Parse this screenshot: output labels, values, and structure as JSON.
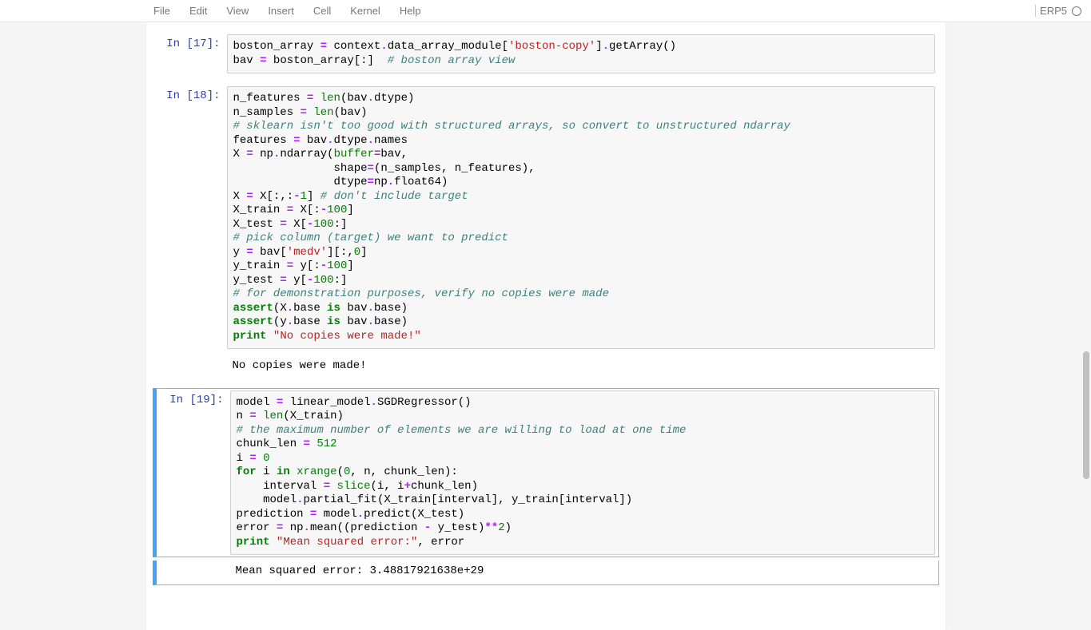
{
  "menu": {
    "file": "File",
    "edit": "Edit",
    "view": "View",
    "insert": "Insert",
    "cell": "Cell",
    "kernel": "Kernel",
    "help": "Help"
  },
  "kernel_name": "ERP5",
  "cells": {
    "c17": {
      "prompt": "In [17]:",
      "t0a": "boston_array ",
      "t0b": "=",
      "t0c": " context",
      "t0d": ".",
      "t0e": "data_array_module[",
      "t0f": "'boston-copy'",
      "t0g": "]",
      "t0h": ".",
      "t0i": "getArray()",
      "t1a": "bav ",
      "t1b": "=",
      "t1c": " boston_array[:]  ",
      "t1d": "# boston array view"
    },
    "c18": {
      "prompt": "In [18]:",
      "l0a": "n_features ",
      "l0b": "=",
      "l0c": " ",
      "l0d": "len",
      "l0e": "(bav",
      "l0f": ".",
      "l0g": "dtype)",
      "l1a": "n_samples ",
      "l1b": "=",
      "l1c": " ",
      "l1d": "len",
      "l1e": "(bav)",
      "l2": "",
      "l3": "# sklearn isn't too good with structured arrays, so convert to unstructured ndarray",
      "l4a": "features ",
      "l4b": "=",
      "l4c": " bav",
      "l4d": ".",
      "l4e": "dtype",
      "l4f": ".",
      "l4g": "names",
      "l5a": "X ",
      "l5b": "=",
      "l5c": " np",
      "l5d": ".",
      "l5e": "ndarray(",
      "l5f": "buffer",
      "l5g": "=",
      "l5h": "bav,",
      "l6a": "               shape",
      "l6b": "=",
      "l6c": "(n_samples, n_features),",
      "l7a": "               dtype",
      "l7b": "=",
      "l7c": "np",
      "l7d": ".",
      "l7e": "float64)",
      "l8": "",
      "l9a": "X ",
      "l9b": "=",
      "l9c": " X[:,:",
      "l9d": "-",
      "l9e": "1",
      "l9f": "] ",
      "l9g": "# don't include target",
      "l10": "",
      "l11a": "X_train ",
      "l11b": "=",
      "l11c": " X[:",
      "l11d": "-",
      "l11e": "100",
      "l11f": "]",
      "l12a": "X_test ",
      "l12b": "=",
      "l12c": " X[",
      "l12d": "-",
      "l12e": "100",
      "l12f": ":]",
      "l13": "",
      "l14": "# pick column (target) we want to predict",
      "l15a": "y ",
      "l15b": "=",
      "l15c": " bav[",
      "l15d": "'medv'",
      "l15e": "][:,",
      "l15f": "0",
      "l15g": "]",
      "l16a": "y_train ",
      "l16b": "=",
      "l16c": " y[:",
      "l16d": "-",
      "l16e": "100",
      "l16f": "]",
      "l17a": "y_test ",
      "l17b": "=",
      "l17c": " y[",
      "l17d": "-",
      "l17e": "100",
      "l17f": ":]",
      "l18": "",
      "l19": "# for demonstration purposes, verify no copies were made",
      "l20a": "assert",
      "l20b": "(X",
      "l20c": ".",
      "l20d": "base ",
      "l20e": "is",
      "l20f": " bav",
      "l20g": ".",
      "l20h": "base)",
      "l21a": "assert",
      "l21b": "(y",
      "l21c": ".",
      "l21d": "base ",
      "l21e": "is",
      "l21f": " bav",
      "l21g": ".",
      "l21h": "base)",
      "l22": "",
      "l23a": "print",
      "l23b": " ",
      "l23c": "\"No copies were made!\"",
      "output": "No copies were made!"
    },
    "c19": {
      "prompt": "In [19]:",
      "m0a": "model ",
      "m0b": "=",
      "m0c": " linear_model",
      "m0d": ".",
      "m0e": "SGDRegressor()",
      "m1a": "n ",
      "m1b": "=",
      "m1c": " ",
      "m1d": "len",
      "m1e": "(X_train)",
      "m2": "# the maximum number of elements we are willing to load at one time",
      "m3a": "chunk_len ",
      "m3b": "=",
      "m3c": " ",
      "m3d": "512",
      "m4a": "i ",
      "m4b": "=",
      "m4c": " ",
      "m4d": "0",
      "m5": "",
      "m6a": "for",
      "m6b": " i ",
      "m6c": "in",
      "m6d": " ",
      "m6e": "xrange",
      "m6f": "(",
      "m6g": "0",
      "m6h": ", n, chunk_len):",
      "m7a": "    interval ",
      "m7b": "=",
      "m7c": " ",
      "m7d": "slice",
      "m7e": "(i, i",
      "m7f": "+",
      "m7g": "chunk_len)",
      "m8a": "    model",
      "m8b": ".",
      "m8c": "partial_fit(X_train[interval], y_train[interval])",
      "m9": "",
      "m10a": "prediction ",
      "m10b": "=",
      "m10c": " model",
      "m10d": ".",
      "m10e": "predict(X_test)",
      "m11": "",
      "m12a": "error ",
      "m12b": "=",
      "m12c": " np",
      "m12d": ".",
      "m12e": "mean((prediction ",
      "m12f": "-",
      "m12g": " y_test)",
      "m12h": "**",
      "m12i": "2",
      "m12j": ")",
      "m13a": "print",
      "m13b": " ",
      "m13c": "\"Mean squared error:\"",
      "m13d": ", error",
      "output": "Mean squared error: 3.48817921638e+29"
    }
  }
}
